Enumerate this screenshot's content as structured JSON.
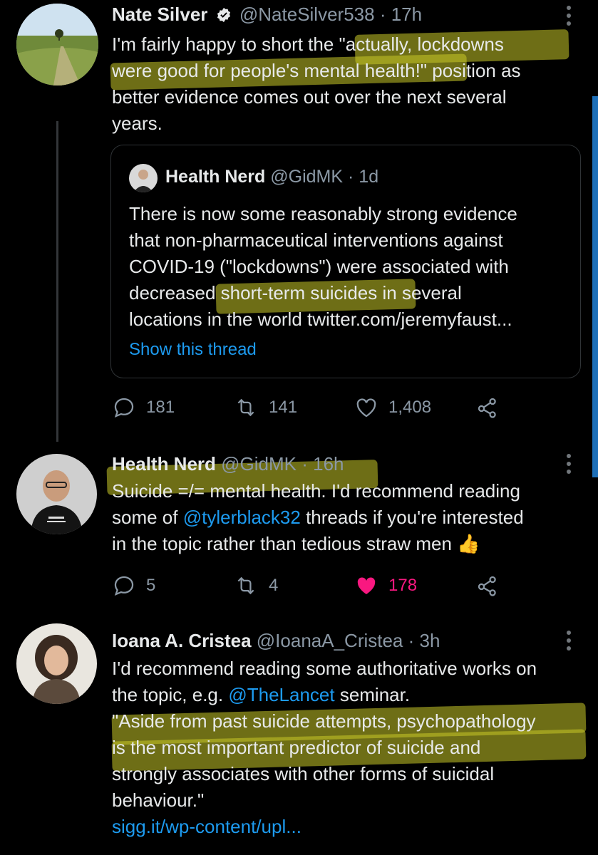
{
  "tweets": [
    {
      "name": "Nate Silver",
      "handle": "@NateSilver538",
      "time": "· 17h",
      "lines": [
        "I'm fairly happy to short the \"actually, lockdowns",
        "were good for people's mental health!\" position as",
        "better evidence comes out over the next several",
        "years."
      ],
      "quote": {
        "name": "Health Nerd",
        "handle": "@GidMK",
        "time": "· 1d",
        "lines": [
          "There is now some reasonably strong evidence",
          "that non-pharmaceutical interventions against",
          "COVID-19 (\"lockdowns\") were associated with",
          "decreased short-term suicides in several",
          "locations in the world twitter.com/jeremyfaust..."
        ],
        "show_thread": "Show this thread"
      },
      "replies": "181",
      "retweets": "141",
      "likes": "1,408"
    },
    {
      "name": "Health Nerd",
      "handle": "@GidMK",
      "time": "· 16h",
      "line1": "Suicide =/= mental health. I'd recommend reading",
      "line2_pre": "some of ",
      "line2_link": "@tylerblack32",
      "line2_post": " threads if you're interested",
      "line3": "in the topic rather than tedious straw men",
      "emoji": "👍",
      "replies": "5",
      "retweets": "4",
      "likes": "178"
    },
    {
      "name": "Ioana A. Cristea",
      "handle": "@IoanaA_Cristea",
      "time": "· 3h",
      "line1": "I'd recommend reading some authoritative works on",
      "line2_pre": "the topic, e.g. ",
      "line2_link": "@TheLancet",
      "line2_post": " seminar.",
      "lines_rest": [
        "\"Aside from past suicide attempts, psychopathology",
        "is the most important predictor of suicide and",
        "strongly  associates with  other forms of suicidal",
        "behaviour.\""
      ],
      "link": "sigg.it/wp-content/upl..."
    }
  ],
  "colors": {
    "background": "#000000",
    "text": "#e7e9ea",
    "muted": "#8b98a5",
    "link": "#1d9bf0",
    "like_active": "#f91880",
    "highlight": "#c8c828"
  },
  "icons": [
    "verified-badge-icon",
    "more-icon",
    "reply-icon",
    "retweet-icon",
    "like-icon",
    "share-icon"
  ]
}
